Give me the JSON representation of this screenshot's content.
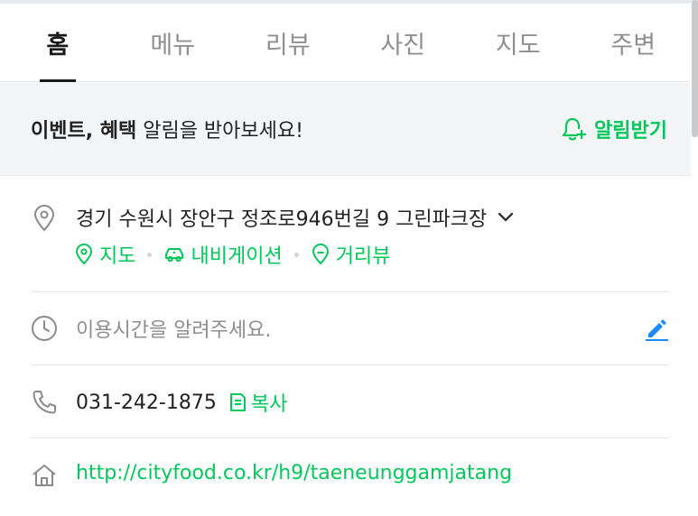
{
  "tabs": [
    {
      "label": "홈",
      "active": true
    },
    {
      "label": "메뉴",
      "active": false
    },
    {
      "label": "리뷰",
      "active": false
    },
    {
      "label": "사진",
      "active": false
    },
    {
      "label": "지도",
      "active": false
    },
    {
      "label": "주변",
      "active": false
    }
  ],
  "banner": {
    "bold_text": "이벤트, 혜택",
    "rest_text": " 알림을 받아보세요!",
    "button_label": "알림받기",
    "button_icon": "bell-plus-icon"
  },
  "address": {
    "icon": "location-pin-icon",
    "text": "경기 수원시 장안구 정조로946번길 9 그린파크장",
    "expand_icon": "chevron-down-icon",
    "links": [
      {
        "label": "지도",
        "icon": "map-pin-icon"
      },
      {
        "label": "내비게이션",
        "icon": "car-icon"
      },
      {
        "label": "거리뷰",
        "icon": "street-view-icon"
      }
    ]
  },
  "hours": {
    "icon": "clock-icon",
    "text": "이용시간을 알려주세요.",
    "edit_icon": "pencil-icon"
  },
  "phone": {
    "icon": "phone-icon",
    "number": "031-242-1875",
    "copy_label": "복사",
    "copy_icon": "copy-icon"
  },
  "homepage": {
    "icon": "home-icon",
    "url": "http://cityfood.co.kr/h9/taeneunggamjatang"
  },
  "colors": {
    "accent": "#03c75a",
    "edit": "#1a8cff",
    "banner_bg": "#f3f5f6"
  }
}
